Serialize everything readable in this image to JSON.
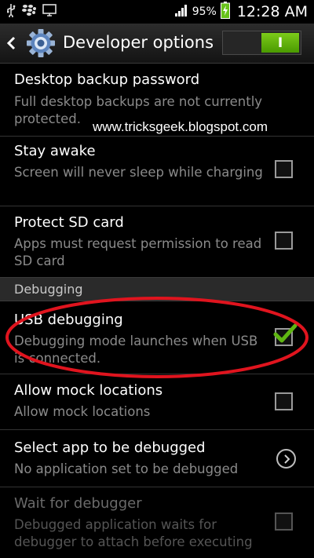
{
  "status_bar": {
    "battery_percent": "95%",
    "time": "12:28 AM",
    "icons": [
      "usb-icon",
      "blackberry-icon",
      "screen-icon",
      "signal-icon",
      "battery-charging-icon"
    ]
  },
  "action_bar": {
    "title": "Developer options",
    "toggle_label": "I",
    "toggle_state": "on"
  },
  "settings": [
    {
      "title": "Desktop backup password",
      "subtitle": "Full desktop backups are not currently protected."
    },
    {
      "title": "Stay awake",
      "subtitle": "Screen will never sleep while charging",
      "checked": false
    },
    {
      "title": "Protect SD card",
      "subtitle": "Apps must request permission to read SD card",
      "checked": false
    }
  ],
  "section_header": "Debugging",
  "debugging": [
    {
      "title": "USB debugging",
      "subtitle": "Debugging mode launches when USB is connected.",
      "checked": true
    },
    {
      "title": "Allow mock locations",
      "subtitle": "Allow mock locations",
      "checked": false
    },
    {
      "title": "Select app to be debugged",
      "subtitle": "No application set to be debugged"
    },
    {
      "title": "Wait for debugger",
      "subtitle": "Debugged application waits for debugger to attach before executing",
      "checked": false,
      "disabled": true
    }
  ],
  "watermark": "www.tricksgeek.blogspot.com",
  "colors": {
    "accent_green": "#5fb612",
    "annotation_red": "#e0141e",
    "subtitle_gray": "#8a8a8a"
  }
}
